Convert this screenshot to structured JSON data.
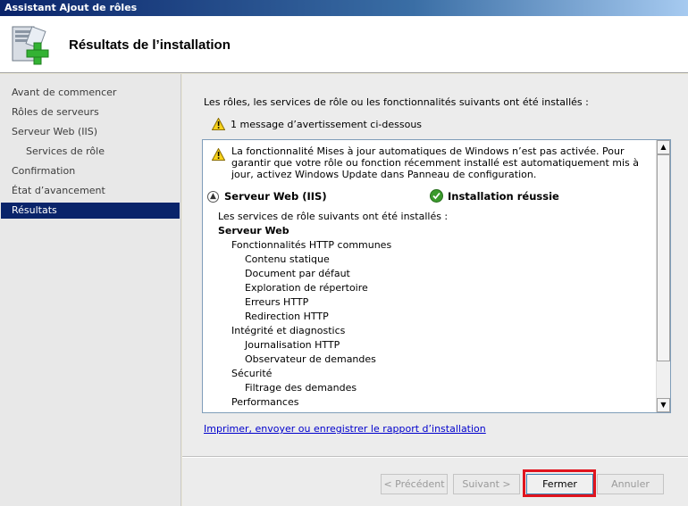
{
  "window": {
    "title": "Assistant Ajout de rôles"
  },
  "header": {
    "title": "Résultats de l’installation",
    "icon": "server-add-icon"
  },
  "nav": {
    "items": [
      {
        "label": "Avant de commencer"
      },
      {
        "label": "Rôles de serveurs"
      },
      {
        "label": "Serveur Web (IIS)"
      },
      {
        "label": "Services de rôle"
      },
      {
        "label": "Confirmation"
      },
      {
        "label": "État d’avancement"
      },
      {
        "label": "Résultats"
      }
    ]
  },
  "content": {
    "intro": "Les rôles, les services de rôle ou les fonctionnalités suivants ont été installés :",
    "warning_count": "1 message d’avertissement ci-dessous",
    "results": {
      "warning": "La fonctionnalité Mises à jour automatiques de Windows n’est pas activée. Pour garantir que votre rôle ou fonction récemment installé est automatiquement mis à jour, activez Windows Update dans Panneau de configuration.",
      "section_name": "Serveur Web (IIS)",
      "status": "Installation réussie",
      "tree": [
        "Les services de rôle suivants ont été installés :",
        "Serveur Web",
        "Fonctionnalités HTTP communes",
        "Contenu statique",
        "Document par défaut",
        "Exploration de répertoire",
        "Erreurs HTTP",
        "Redirection HTTP",
        "Intégrité et diagnostics",
        "Journalisation HTTP",
        "Observateur de demandes",
        "Sécurité",
        "Filtrage des demandes",
        "Performances"
      ]
    },
    "report_link": "Imprimer, envoyer ou enregistrer le rapport d’installation"
  },
  "buttons": {
    "previous": "< Précédent",
    "next": "Suivant >",
    "close": "Fermer",
    "cancel": "Annuler"
  },
  "colors": {
    "nav_selected": "#0a246a",
    "highlight_frame": "#e0141e",
    "link": "#0000cc"
  }
}
